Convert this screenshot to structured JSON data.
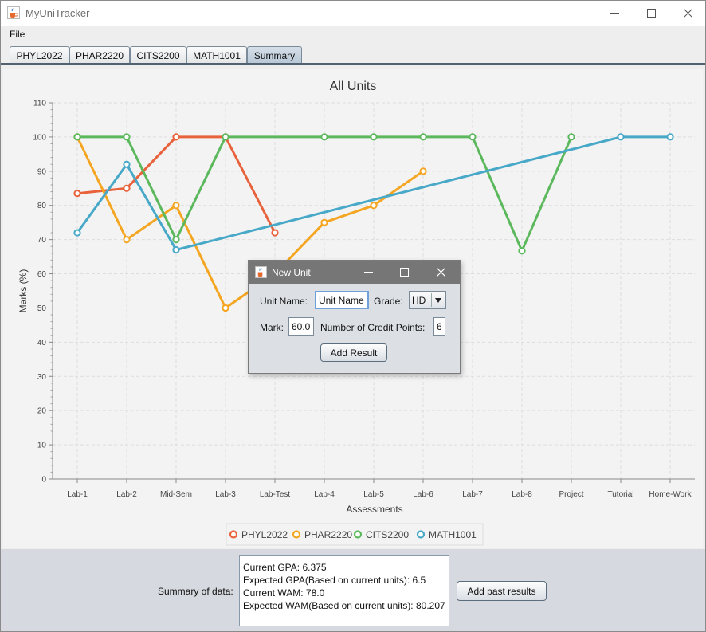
{
  "window": {
    "title": "MyUniTracker"
  },
  "menu": {
    "file": "File"
  },
  "tabs": [
    "PHYL2022",
    "PHAR2220",
    "CITS2200",
    "MATH1001",
    "Summary"
  ],
  "selected_tab": "Summary",
  "chart_data": {
    "type": "line",
    "title": "All Units",
    "xlabel": "Assessments",
    "ylabel": "Marks (%)",
    "ylim": [
      0,
      110
    ],
    "yticks": [
      0,
      10,
      20,
      30,
      40,
      50,
      60,
      70,
      80,
      90,
      100,
      110
    ],
    "grid": true,
    "legend_position": "bottom",
    "categories": [
      "Lab-1",
      "Lab-2",
      "Mid-Sem",
      "Lab-3",
      "Lab-Test",
      "Lab-4",
      "Lab-5",
      "Lab-6",
      "Lab-7",
      "Lab-8",
      "Project",
      "Tutorial",
      "Home-Work"
    ],
    "series": [
      {
        "name": "PHYL2022",
        "color": "#e8623c",
        "points": [
          [
            "Lab-1",
            83.5
          ],
          [
            "Lab-2",
            85
          ],
          [
            "Mid-Sem",
            100
          ],
          [
            "Lab-3",
            100
          ],
          [
            "Lab-Test",
            72
          ]
        ]
      },
      {
        "name": "PHAR2220",
        "color": "#f4a623",
        "points": [
          [
            "Lab-1",
            100
          ],
          [
            "Lab-2",
            70
          ],
          [
            "Mid-Sem",
            80
          ],
          [
            "Lab-3",
            50
          ],
          [
            "Lab-Test",
            60
          ],
          [
            "Lab-4",
            75
          ],
          [
            "Lab-5",
            80
          ],
          [
            "Lab-6",
            90
          ]
        ]
      },
      {
        "name": "CITS2200",
        "color": "#5cb85c",
        "points": [
          [
            "Lab-1",
            100
          ],
          [
            "Lab-2",
            100
          ],
          [
            "Mid-Sem",
            70
          ],
          [
            "Lab-3",
            100
          ],
          [
            "Lab-4",
            100
          ],
          [
            "Lab-5",
            100
          ],
          [
            "Lab-6",
            100
          ],
          [
            "Lab-7",
            100
          ],
          [
            "Lab-8",
            66.7
          ],
          [
            "Project",
            100
          ]
        ]
      },
      {
        "name": "MATH1001",
        "color": "#48a8c8",
        "points": [
          [
            "Lab-1",
            72
          ],
          [
            "Lab-2",
            92
          ],
          [
            "Mid-Sem",
            67
          ],
          [
            "Tutorial",
            100
          ],
          [
            "Home-Work",
            100
          ]
        ]
      }
    ]
  },
  "summary": {
    "label": "Summary of data:",
    "lines": [
      "Current GPA: 6.375",
      "Expected GPA(Based on current units): 6.5",
      "Current WAM: 78.0",
      "Expected WAM(Based on current units): 80.207"
    ],
    "add_past_button": "Add past results"
  },
  "dialog": {
    "title": "New Unit",
    "unit_name_label": "Unit Name:",
    "unit_name_value": "Unit Name",
    "grade_label": "Grade:",
    "grade_value": "HD",
    "mark_label": "Mark:",
    "mark_value": "60.0",
    "credit_label": "Number of Credit Points:",
    "credit_value": "6",
    "add_button": "Add Result"
  },
  "icons": [
    "java-cup-icon",
    "minimize-icon",
    "maximize-icon",
    "close-icon",
    "dropdown-arrow-icon"
  ]
}
